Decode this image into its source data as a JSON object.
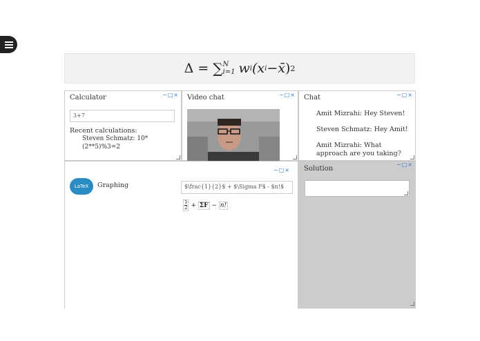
{
  "header": {
    "formula_lhs": "Δ",
    "formula_eq": "=",
    "formula_sum": "∑",
    "formula_sub": "i=1",
    "formula_sup": "N",
    "formula_body": "w",
    "formula_wsub": "i",
    "formula_open": "(x",
    "formula_xsub": "i",
    "formula_minus": " − ",
    "formula_xbar": "x̄",
    "formula_close": ")",
    "formula_exp": "2"
  },
  "panel_controls": {
    "minimize": "−",
    "maximize": "□",
    "close": "×"
  },
  "calculator": {
    "title": "Calculator",
    "input_value": "3+7",
    "recent_label": "Recent calculations:",
    "recent_entry": "Steven Schmatz: 10* (2**5)%3=2"
  },
  "video_chat": {
    "title": "Video chat"
  },
  "chat": {
    "title": "Chat",
    "messages": [
      "Amit Mizrahi: Hey Steven!",
      "Steven Schmatz: Hey Amit!",
      "Amit Mizrahi: What approach are you taking?"
    ]
  },
  "graphing": {
    "badge": "LaTeX",
    "label": "Graphing",
    "latex_value": "$\\frac{1}{2}$ + $\\Sigma F$ - $n!$",
    "render_num": "1",
    "render_den": "2",
    "render_plus": " + ",
    "render_sigma": "ΣF",
    "render_minus": " − ",
    "render_n": "n!"
  },
  "solution": {
    "title": "Solution",
    "input_value": ""
  },
  "colors": {
    "accent": "#2b7bd6",
    "badge": "#2b8cc4",
    "solution_bg": "#cccccc",
    "formula_bg": "#f2f2f2"
  }
}
